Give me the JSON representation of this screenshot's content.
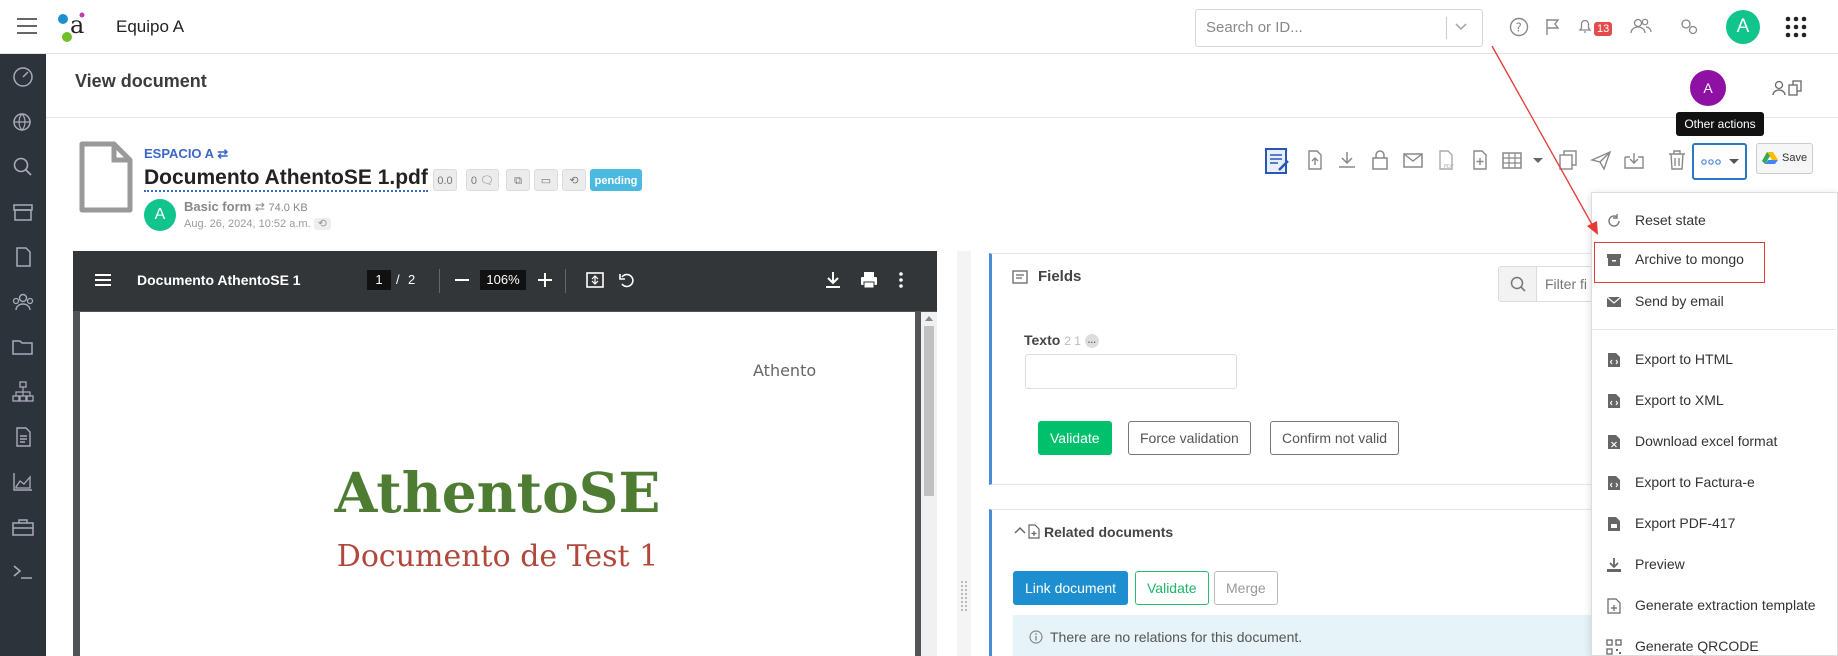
{
  "header": {
    "workspace": "Equipo A",
    "search_placeholder": "Search or ID...",
    "notifications_count": "13",
    "user_initial": "A"
  },
  "page": {
    "title": "View document",
    "owner_initial": "A"
  },
  "document": {
    "space": "ESPACIO A",
    "title": "Documento AthentoSE 1.pdf",
    "version": "0.0",
    "comments": "0",
    "status": "pending",
    "form": "Basic form",
    "size": "74.0 KB",
    "date": "Aug. 26, 2024, 10:52 a.m.",
    "author_initial": "A"
  },
  "toolbar": {
    "tooltip": "Other actions",
    "save_label": "Save"
  },
  "pdf": {
    "name": "Documento AthentoSE 1",
    "page_current": "1",
    "page_sep": "/",
    "page_total": "2",
    "zoom": "106%",
    "header_text": "Athento",
    "big_title": "AthentoSE",
    "subtitle": "Documento de Test 1"
  },
  "fields_panel": {
    "title": "Fields",
    "filter_placeholder": "Filter fi",
    "field_label": "Texto",
    "field_meta": "2 1",
    "field_value": "",
    "validate": "Validate",
    "force_validation": "Force validation",
    "confirm_not_valid": "Confirm not valid"
  },
  "related_panel": {
    "title": "Related documents",
    "link_document": "Link document",
    "validate": "Validate",
    "merge": "Merge",
    "empty_message": "There are no relations for this document."
  },
  "dropdown": {
    "items": [
      {
        "label": "Reset state",
        "icon": "reset-icon"
      },
      {
        "label": "Archive to mongo",
        "icon": "archive-icon"
      },
      {
        "label": "Send by email",
        "icon": "mail-icon"
      },
      {
        "label": "Export to HTML",
        "icon": "file-code-icon"
      },
      {
        "label": "Export to XML",
        "icon": "file-code-icon"
      },
      {
        "label": "Download excel format",
        "icon": "file-excel-icon"
      },
      {
        "label": "Export to Factura-e",
        "icon": "file-code-icon"
      },
      {
        "label": "Export PDF-417",
        "icon": "file-pdf-icon"
      },
      {
        "label": "Preview",
        "icon": "download-icon"
      },
      {
        "label": "Generate extraction template",
        "icon": "file-plus-icon"
      },
      {
        "label": "Generate QRCODE",
        "icon": "qrcode-icon"
      }
    ]
  },
  "colors": {
    "sidebar": "#2d333a",
    "accent_green": "#00c06b",
    "accent_blue": "#1d8fd1",
    "highlight_red": "#e53935"
  }
}
